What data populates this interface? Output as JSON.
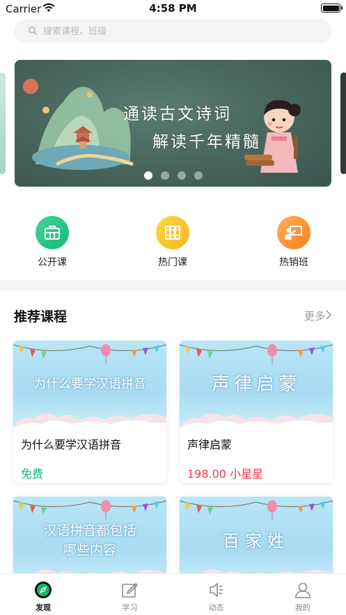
{
  "status_bar": {
    "carrier": "Carrier",
    "time": "4:58 PM",
    "battery_level": 1.0
  },
  "search": {
    "placeholder": "搜索课程、班级",
    "icon": "search-icon"
  },
  "banner": {
    "line1": "通读古文诗词",
    "line2": "解读千年精髓",
    "slide_count": 4,
    "active_slide": 1
  },
  "categories": [
    {
      "label": "公开课",
      "icon": "briefcase-icon",
      "color": "#22c07f"
    },
    {
      "label": "热门课",
      "icon": "books-icon",
      "color": "#f9c325"
    },
    {
      "label": "热销班",
      "icon": "presentation-board-icon",
      "color": "#f79232"
    }
  ],
  "recommended": {
    "title": "推荐课程",
    "more_label": "更多",
    "courses": [
      {
        "thumb_text": "为什么要学汉语拼音",
        "title": "为什么要学汉语拼音",
        "price": "免费"
      },
      {
        "thumb_text": "声律启蒙",
        "title": "声律启蒙",
        "price": "198.00 小星星"
      },
      {
        "thumb_line1": "汉语拼音都包括",
        "thumb_line2": "哪些内容"
      },
      {
        "thumb_text": "百家姓"
      }
    ]
  },
  "tabbar": {
    "items": [
      {
        "label": "发现",
        "icon": "compass-icon",
        "active": true
      },
      {
        "label": "学习",
        "icon": "notepad-pencil-icon",
        "active": false
      },
      {
        "label": "动态",
        "icon": "speaker-icon",
        "active": false
      },
      {
        "label": "我的",
        "icon": "person-icon",
        "active": false
      }
    ]
  },
  "colors": {
    "accent_green": "#12b76a",
    "price_red": "#f03a4d",
    "muted": "#9a9a9a"
  }
}
